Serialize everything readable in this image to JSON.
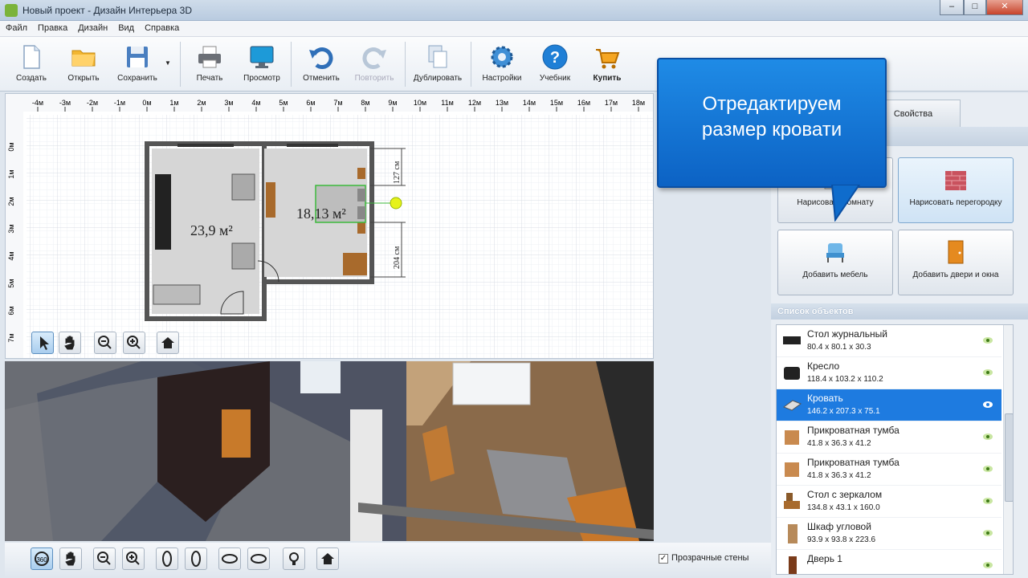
{
  "window": {
    "title": "Новый проект - Дизайн Интерьера 3D",
    "minimize": "–",
    "maximize": "□",
    "close": "✕"
  },
  "menu": [
    "Файл",
    "Правка",
    "Дизайн",
    "Вид",
    "Справка"
  ],
  "toolbar": {
    "create": "Создать",
    "open": "Открыть",
    "save": "Сохранить",
    "print": "Печать",
    "preview": "Просмотр",
    "undo": "Отменить",
    "redo": "Повторить",
    "duplicate": "Дублировать",
    "settings": "Настройки",
    "tutorial": "Учебник",
    "buy": "Купить"
  },
  "plan": {
    "ruler_top": [
      "-4м",
      "-3м",
      "-2м",
      "-1м",
      "0м",
      "1м",
      "2м",
      "3м",
      "4м",
      "5м",
      "6м",
      "7м",
      "8м",
      "9м",
      "10м",
      "11м",
      "12м",
      "13м",
      "14м",
      "15м",
      "16м",
      "17м",
      "18м"
    ],
    "ruler_left": [
      "0м",
      "1м",
      "2м",
      "3м",
      "4м",
      "5м",
      "6м",
      "7м"
    ],
    "room1_area": "23,9 м²",
    "room2_area": "18,13 м²",
    "dim_top": "127 см",
    "dim_bottom": "204 см"
  },
  "view3d": {
    "transparent_walls": "Прозрачные стены",
    "transparent_checked": true
  },
  "right_panel": {
    "tab_properties": "Свойства",
    "draw_room": "Нарисовать комнату",
    "draw_partition": "Нарисовать перегородку",
    "add_furniture": "Добавить мебель",
    "add_doors": "Добавить двери и окна",
    "objects_header": "Список объектов",
    "objects": [
      {
        "name": "Стол журнальный",
        "dims": "80.4 x 80.1 x 30.3"
      },
      {
        "name": "Кресло",
        "dims": "118.4 x 103.2 x 110.2"
      },
      {
        "name": "Кровать",
        "dims": "146.2 x 207.3 x 75.1"
      },
      {
        "name": "Прикроватная тумба",
        "dims": "41.8 x 36.3 x 41.2"
      },
      {
        "name": "Прикроватная тумба",
        "dims": "41.8 x 36.3 x 41.2"
      },
      {
        "name": "Стол с зеркалом",
        "dims": "134.8 x 43.1 x 160.0"
      },
      {
        "name": "Шкаф угловой",
        "dims": "93.9 x 93.8 x 223.6"
      },
      {
        "name": "Дверь 1",
        "dims": ""
      }
    ]
  },
  "callout": {
    "line1": "Отредактируем",
    "line2": "размер кровати"
  },
  "colors": {
    "accent": "#1e7be0",
    "callout": "#1378d8",
    "wall": "#555555",
    "floor": "#8a6a4a"
  }
}
